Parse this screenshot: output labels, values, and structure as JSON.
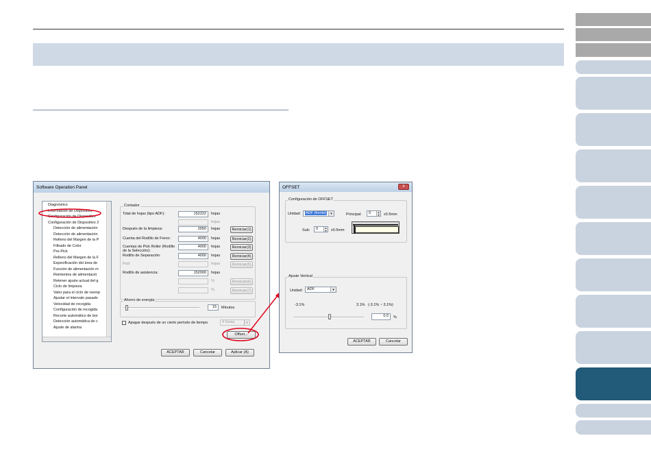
{
  "left_window": {
    "title": "Software Operation Panel",
    "tree_items": [
      "Diagnóstico",
      "Información de Dispositivo",
      "Configuración de Dispositivo",
      "Configuración de Dispositivo 2",
      "Detección de alimentación",
      "Detección de alimentación",
      "Relleno del Margen de la P",
      "Filtrado de Color",
      "Pre-Pick",
      "Relleno del Margen de la F",
      "Especificación del área de",
      "Función de alimentación m",
      "Reintentos de alimentació",
      "Retener ajuste actual del g",
      "Ciclo de limpieza",
      "Valor para el ciclo de reemp",
      "Ajustar el intervalo pasado",
      "Velocidad de recogida",
      "Configuración de recogida",
      "Recorte automático de bor",
      "Detección automática de c",
      "Ajuste de alarma"
    ],
    "counter": {
      "group_label": "Contador",
      "rows": [
        {
          "label": "Total de hojas (tipo ADF):",
          "value": "152222",
          "unit": "hojas",
          "button": ""
        },
        {
          "label": "",
          "value": "",
          "unit": "hojas",
          "button": ""
        },
        {
          "label": "Después de la limpieza:",
          "value": "2050",
          "unit": "hojas",
          "button": "Reiniciar(1)"
        },
        {
          "label": "Cuenta del Rodillo de Freno:",
          "value": "4000",
          "unit": "hojas",
          "button": "Reiniciar(2)"
        },
        {
          "label": "Cuentas de Pick Roller (Rodillo de la Selección):",
          "value": "4000",
          "unit": "hojas",
          "button": "Reiniciar(3)"
        },
        {
          "label": "Rodillo de Separación:",
          "value": "4000",
          "unit": "hojas",
          "button": "Reiniciar(4)"
        },
        {
          "label": "Pad:",
          "value": "",
          "unit": "hojas",
          "button": "Reiniciar(5)"
        },
        {
          "label": "Rodillo de asistencia:",
          "value": "152000",
          "unit": "hojas",
          "button": ""
        },
        {
          "label": "",
          "value": "",
          "unit": "%",
          "button": "Reiniciar(6)"
        },
        {
          "label": "",
          "value": "",
          "unit": "%",
          "button": "Reiniciar(7)"
        }
      ]
    },
    "energy": {
      "group_label": "Ahorro de energía",
      "minutes_value": "15",
      "minutes_unit": "Minutos",
      "checkbox_label": "Apagar después de un cierto período de tiempo",
      "hours_select": "4 horas"
    },
    "offset_button": "Offset...",
    "ok_button": "ACEPTAR",
    "cancel_button": "Cancelar",
    "apply_button": "Aplicar (A)"
  },
  "right_window": {
    "title": "OFFSET",
    "close_glyph": "x",
    "config_group": "Configuración de OFFSET",
    "unit_label": "Unidad:",
    "unit_value": "ADF (frente)",
    "principal_label": "Principal:",
    "principal_value": "0",
    "principal_unit": "x0.5mm",
    "sub_label": "Sub:",
    "sub_value": "0",
    "sub_unit": "x0.5mm",
    "vertical_group": "Ajuste Vertical",
    "vunit_label": "Unidad:",
    "vunit_value": "ADF",
    "range_left": "-3.1%",
    "range_right": "3.1%",
    "range_hint": "(-3.1% ~ 3.1%)",
    "percent_value": "0.0",
    "percent_unit": "%",
    "ok_button": "ACEPTAR",
    "cancel_button": "Cancelar"
  }
}
